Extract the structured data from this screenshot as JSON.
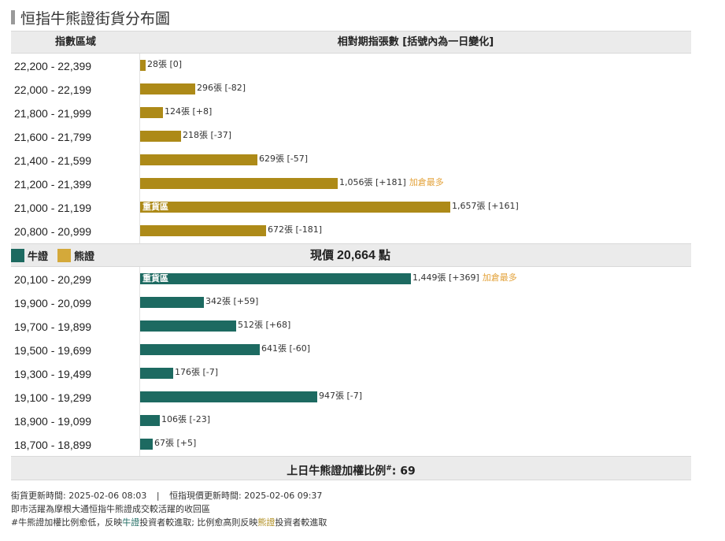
{
  "title": "恒指牛熊證街貨分布圖",
  "header": {
    "col1": "指數區域",
    "col2": "相對期指張數 [括號內為一日變化]"
  },
  "legend": {
    "bull": "牛證",
    "bear": "熊證"
  },
  "price": {
    "label": "現價",
    "value": "20,664",
    "unit": "點"
  },
  "colors": {
    "bear": "#ad8a18",
    "bull": "#1d6a61",
    "accent": "#e3a23a"
  },
  "chart_data": {
    "type": "bar",
    "orientation": "horizontal",
    "xlim": [
      0,
      2000
    ],
    "unit": "張",
    "bear": [
      {
        "range": "22,200 - 22,399",
        "value": 28,
        "value_label": "28",
        "change": "0",
        "note": "",
        "heavy": ""
      },
      {
        "range": "22,000 - 22,199",
        "value": 296,
        "value_label": "296",
        "change": "-82",
        "note": "",
        "heavy": ""
      },
      {
        "range": "21,800 - 21,999",
        "value": 124,
        "value_label": "124",
        "change": "+8",
        "note": "",
        "heavy": ""
      },
      {
        "range": "21,600 - 21,799",
        "value": 218,
        "value_label": "218",
        "change": "-37",
        "note": "",
        "heavy": ""
      },
      {
        "range": "21,400 - 21,599",
        "value": 629,
        "value_label": "629",
        "change": "-57",
        "note": "",
        "heavy": ""
      },
      {
        "range": "21,200 - 21,399",
        "value": 1056,
        "value_label": "1,056",
        "change": "+181",
        "note": "加倉最多",
        "heavy": ""
      },
      {
        "range": "21,000 - 21,199",
        "value": 1657,
        "value_label": "1,657",
        "change": "+161",
        "note": "",
        "heavy": "重貨區"
      },
      {
        "range": "20,800 - 20,999",
        "value": 672,
        "value_label": "672",
        "change": "-181",
        "note": "",
        "heavy": ""
      }
    ],
    "bull": [
      {
        "range": "20,100 - 20,299",
        "value": 1449,
        "value_label": "1,449",
        "change": "+369",
        "note": "加倉最多",
        "heavy": "重貨區"
      },
      {
        "range": "19,900 - 20,099",
        "value": 342,
        "value_label": "342",
        "change": "+59",
        "note": "",
        "heavy": ""
      },
      {
        "range": "19,700 - 19,899",
        "value": 512,
        "value_label": "512",
        "change": "+68",
        "note": "",
        "heavy": ""
      },
      {
        "range": "19,500 - 19,699",
        "value": 641,
        "value_label": "641",
        "change": "-60",
        "note": "",
        "heavy": ""
      },
      {
        "range": "19,300 - 19,499",
        "value": 176,
        "value_label": "176",
        "change": "-7",
        "note": "",
        "heavy": ""
      },
      {
        "range": "19,100 - 19,299",
        "value": 947,
        "value_label": "947",
        "change": "-7",
        "note": "",
        "heavy": ""
      },
      {
        "range": "18,900 - 19,099",
        "value": 106,
        "value_label": "106",
        "change": "-23",
        "note": "",
        "heavy": ""
      },
      {
        "range": "18,700 - 18,899",
        "value": 67,
        "value_label": "67",
        "change": "+5",
        "note": "",
        "heavy": ""
      }
    ]
  },
  "ratio": {
    "label": "上日牛熊證加權比例",
    "mark": "#",
    "value": "69"
  },
  "footer": {
    "street_update_label": "街貨更新時間:",
    "street_update_time": "2025-02-06 08:03",
    "separator": "|",
    "index_update_label": "恒指現價更新時間:",
    "index_update_time": "2025-02-06 09:37",
    "note1": "即市活躍為摩根大通恒指牛熊證成交較活躍的收回區",
    "note2_a": "#牛熊證加權比例愈低，反映",
    "note2_bull": "牛證",
    "note2_b": "投資者較進取; 比例愈高則反映",
    "note2_bear": "熊證",
    "note2_c": "投資者較進取"
  }
}
